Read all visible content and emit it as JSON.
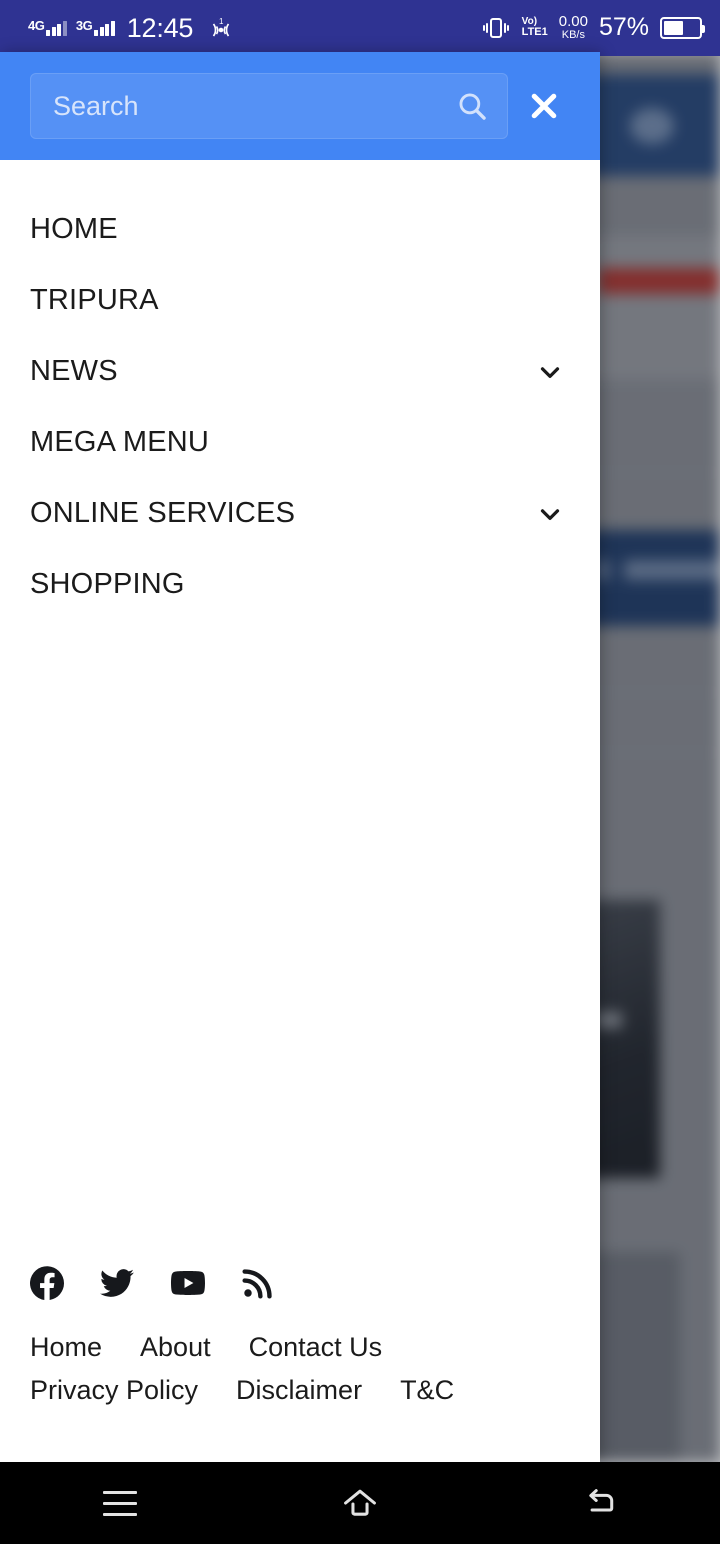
{
  "status_bar": {
    "network_1": "4G",
    "network_2": "3G",
    "clock": "12:45",
    "hotspot_icon": "hotspot-icon",
    "vibrate_icon": "vibrate-icon",
    "volte_line1": "Vo)",
    "volte_line2": "LTE1",
    "data_rate": "0.00",
    "data_unit": "KB/s",
    "battery_percent": "57%",
    "background_color": "#2f3392"
  },
  "search": {
    "placeholder": "Search",
    "value": "",
    "search_icon": "search-icon",
    "close_label": "✕",
    "header_color": "#4285f4"
  },
  "nav": {
    "items": [
      {
        "label": "HOME",
        "has_caret": false
      },
      {
        "label": "TRIPURA",
        "has_caret": false
      },
      {
        "label": "NEWS",
        "has_caret": true
      },
      {
        "label": "MEGA MENU",
        "has_caret": false
      },
      {
        "label": "ONLINE SERVICES",
        "has_caret": true
      },
      {
        "label": "SHOPPING",
        "has_caret": false
      }
    ]
  },
  "footer": {
    "social": [
      {
        "name": "facebook-icon"
      },
      {
        "name": "twitter-icon"
      },
      {
        "name": "youtube-icon"
      },
      {
        "name": "rss-icon"
      }
    ],
    "links_row_1": [
      "Home",
      "About",
      "Contact Us"
    ],
    "links_row_2": [
      "Privacy Policy",
      "Disclaimer",
      "T&C"
    ]
  },
  "system_nav": {
    "recents_label": "recents-icon",
    "home_label": "home-icon",
    "back_label": "back-icon"
  }
}
